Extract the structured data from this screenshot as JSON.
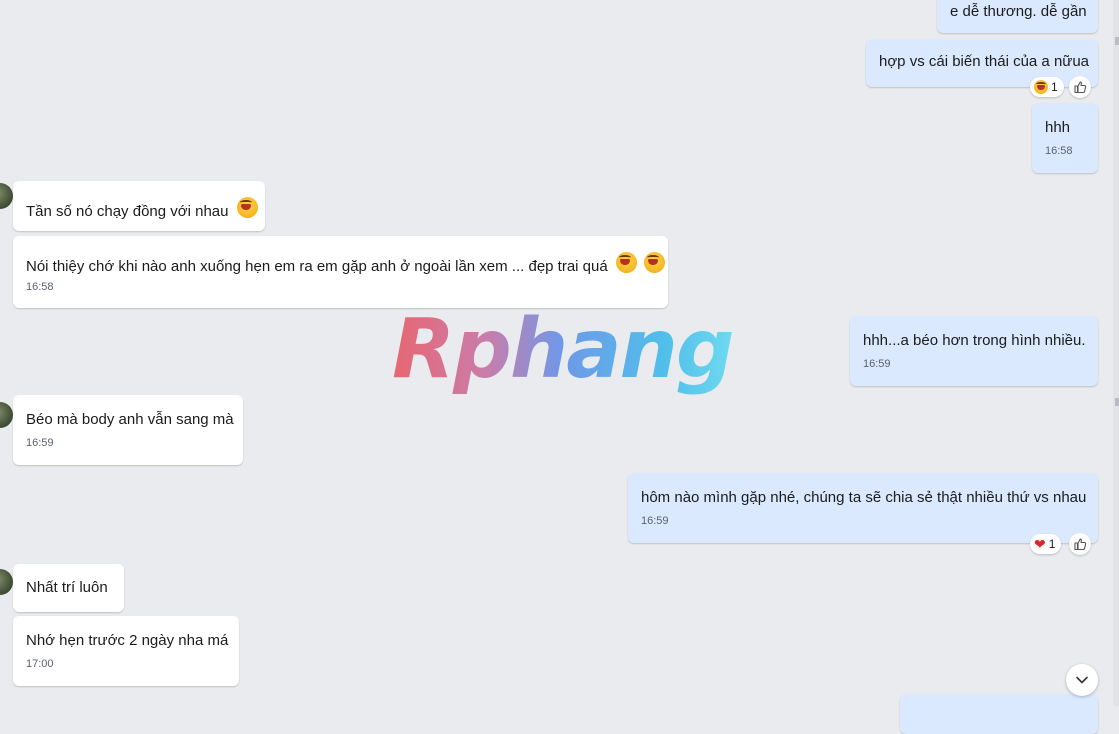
{
  "messages": [
    {
      "side": "mine",
      "text": "e dễ thương. dễ gần",
      "time": ""
    },
    {
      "side": "mine",
      "text": "hợp vs cái biến thái của a nữua",
      "time": "",
      "reaction": {
        "emoji": "laugh",
        "count": "1"
      }
    },
    {
      "side": "mine",
      "text": "hhh",
      "time": "16:58"
    },
    {
      "side": "theirs",
      "text": "Tần số nó chạy đồng với nhau",
      "time": ""
    },
    {
      "side": "theirs",
      "text": "Nói thiệy chớ khi nào anh xuống hẹn em ra em gặp anh ở ngoài lần xem ... đẹp trai quá",
      "time": "16:58"
    },
    {
      "side": "mine",
      "text": "hhh...a béo hơn trong hình nhiều.",
      "time": "16:59"
    },
    {
      "side": "theirs",
      "text": "Béo mà body anh vẫn sang mà",
      "time": "16:59"
    },
    {
      "side": "mine",
      "text": "hôm nào mình gặp nhé, chúng ta sẽ chia sẻ thật nhiều thứ vs nhau",
      "time": "16:59",
      "reaction": {
        "emoji": "heart",
        "count": "1"
      }
    },
    {
      "side": "theirs",
      "text": "Nhất trí luôn",
      "time": ""
    },
    {
      "side": "theirs",
      "text": "Nhớ hẹn trước 2 ngày nha má",
      "time": "17:00"
    }
  ],
  "watermark": "Rphang",
  "colors": {
    "mine_bubble": "#dbe9ff",
    "theirs_bubble": "#ffffff",
    "background": "#e9ebee"
  },
  "icons": {
    "reaction_like": "thumbs-up-icon",
    "scroll": "chevron-down-icon"
  }
}
